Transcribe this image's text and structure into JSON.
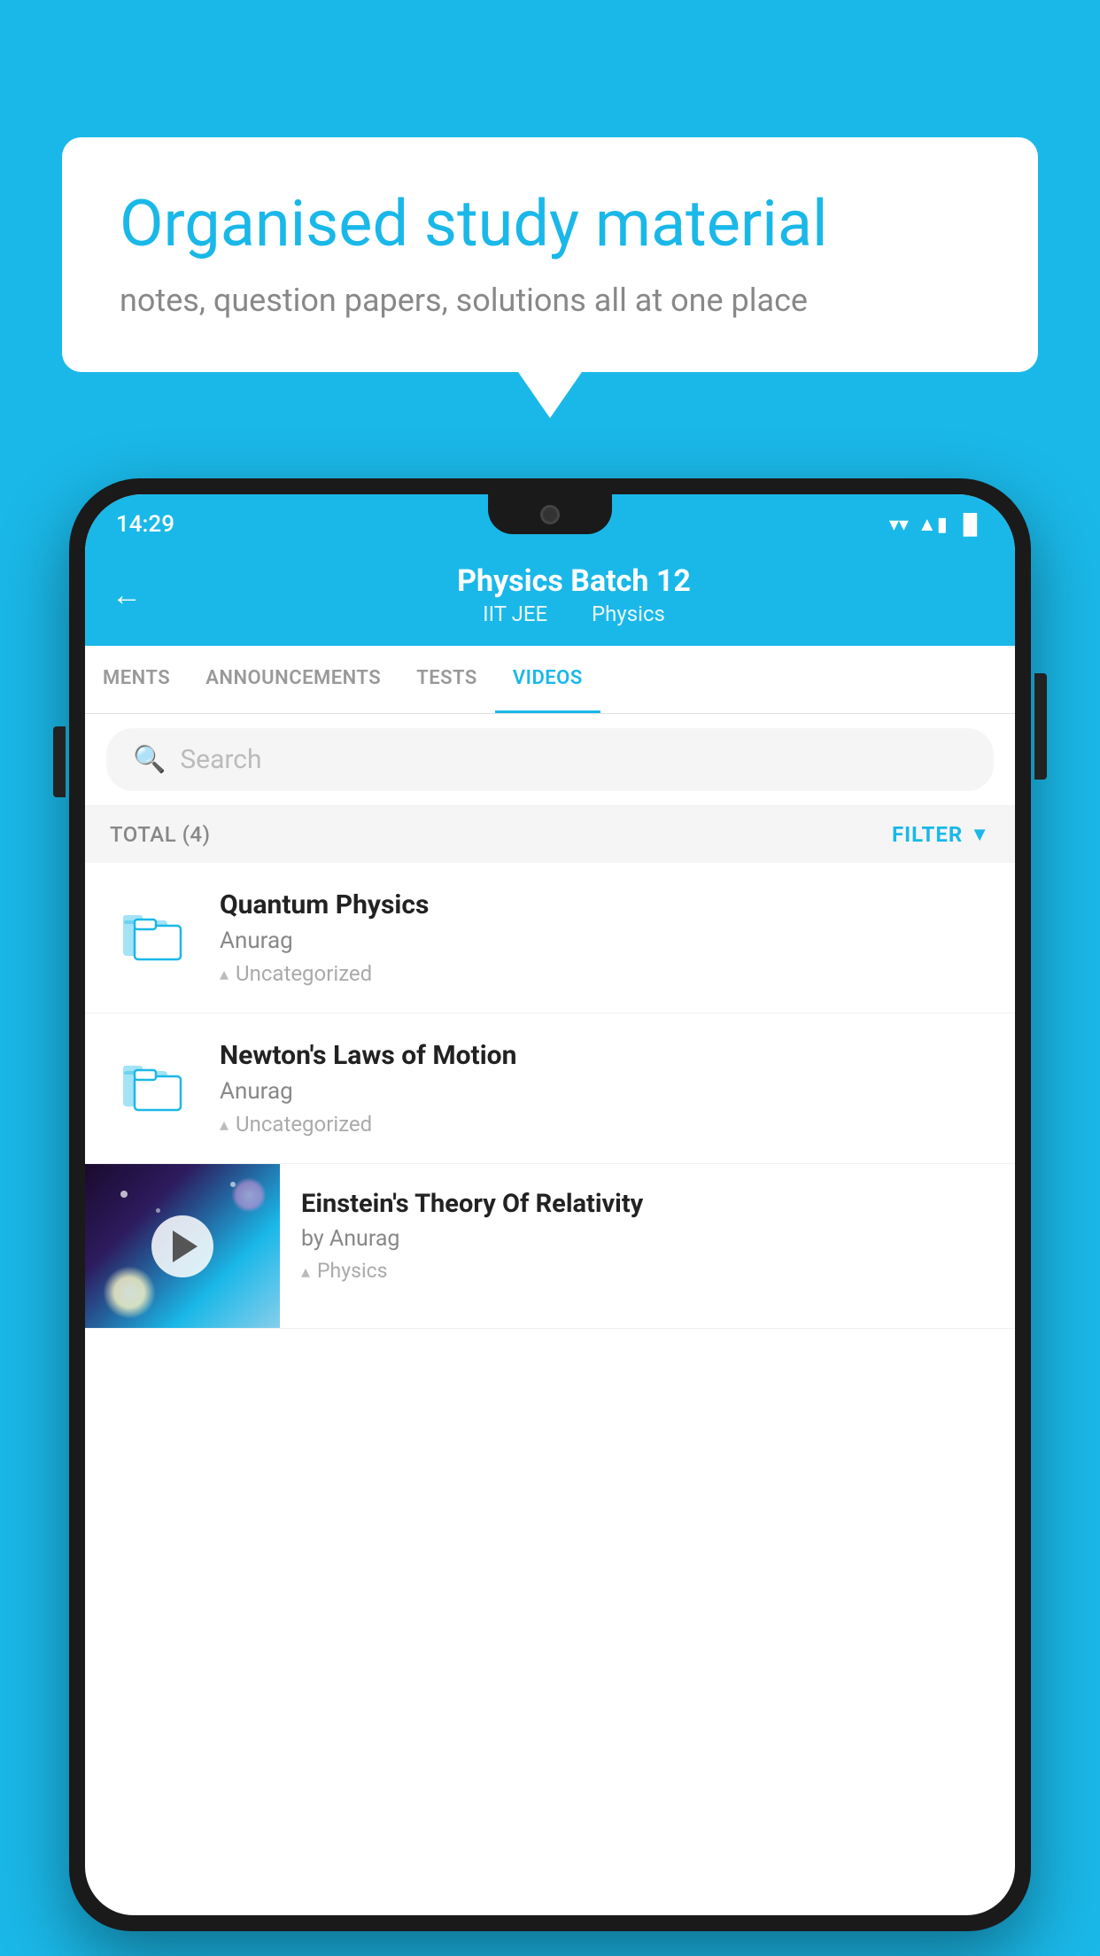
{
  "background_color": "#1ab8e8",
  "speech_bubble": {
    "heading": "Organised study material",
    "subtext": "notes, question papers, solutions all at one place"
  },
  "phone": {
    "status_bar": {
      "time": "14:29",
      "wifi": "▼",
      "signal": "▲",
      "battery": "▐"
    },
    "header": {
      "title": "Physics Batch 12",
      "subtitle_part1": "IIT JEE",
      "subtitle_part2": "Physics",
      "back_label": "←"
    },
    "tabs": [
      {
        "label": "MENTS",
        "active": false
      },
      {
        "label": "ANNOUNCEMENTS",
        "active": false
      },
      {
        "label": "TESTS",
        "active": false
      },
      {
        "label": "VIDEOS",
        "active": true
      }
    ],
    "search": {
      "placeholder": "Search"
    },
    "filter_bar": {
      "total_label": "TOTAL (4)",
      "filter_label": "FILTER"
    },
    "videos": [
      {
        "id": 1,
        "title": "Quantum Physics",
        "author": "Anurag",
        "tag": "Uncategorized",
        "has_thumbnail": false
      },
      {
        "id": 2,
        "title": "Newton's Laws of Motion",
        "author": "Anurag",
        "tag": "Uncategorized",
        "has_thumbnail": false
      },
      {
        "id": 3,
        "title": "Einstein's Theory Of Relativity",
        "author": "by Anurag",
        "tag": "Physics",
        "has_thumbnail": true
      }
    ]
  }
}
